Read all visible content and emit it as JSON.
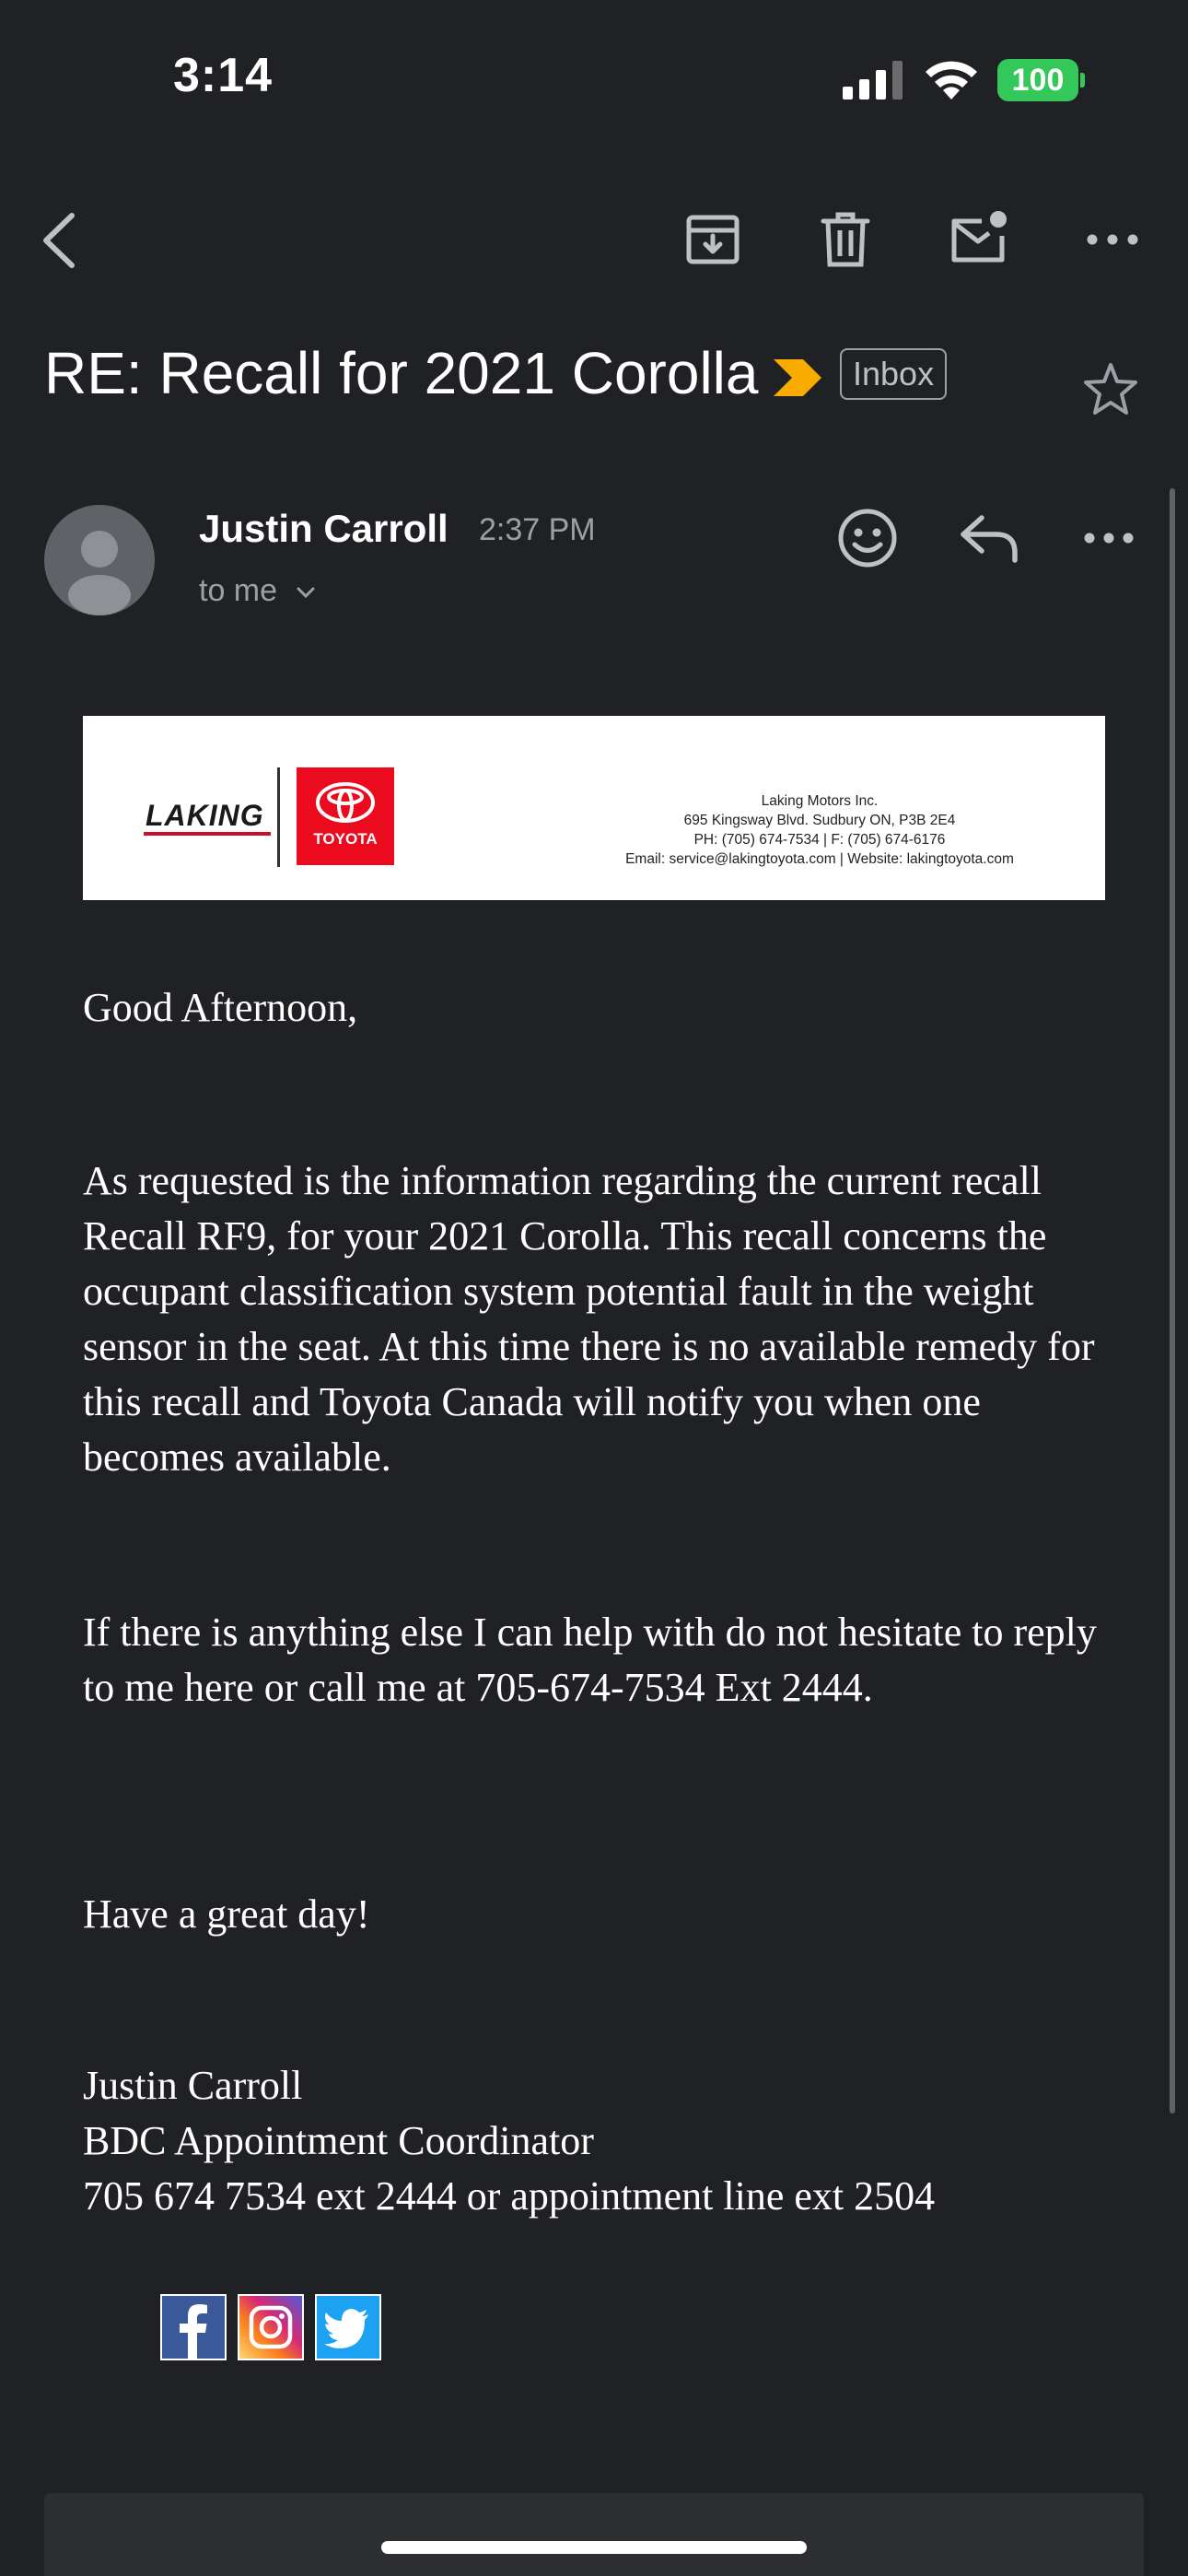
{
  "status_bar": {
    "time": "3:14",
    "battery": "100",
    "icons": [
      "signal-icon",
      "wifi-icon",
      "battery-icon"
    ]
  },
  "toolbar": {
    "icons": [
      "back-icon",
      "archive-icon",
      "trash-icon",
      "mark-unread-icon",
      "more-icon"
    ]
  },
  "email": {
    "subject": "RE: Recall for 2021 Corolla",
    "label": "Inbox",
    "sender": "Justin Carroll",
    "time": "2:37 PM",
    "recipient": "to me",
    "banner": {
      "brand": "LAKING",
      "logo_text": "TOYOTA",
      "company": "Laking Motors Inc.",
      "address": "695 Kingsway Blvd. Sudbury ON, P3B 2E4",
      "phone": "PH: (705) 674-7534 | F: (705) 674-6176",
      "contact": "Email: service@lakingtoyota.com | Website: lakingtoyota.com"
    },
    "greeting": "Good Afternoon,",
    "paragraph1": "As requested is the information regarding the current recall Recall RF9, for your 2021 Corolla. This recall concerns the occupant classification system potential fault in the weight sensor in the seat. At this time there is no available remedy for this recall and Toyota Canada will notify you when one becomes available.",
    "paragraph2": "If there is anything else I can help with do not hesitate to reply to me here or call me at 705-674-7534 Ext 2444.",
    "closing": "Have a great day!",
    "signature": {
      "name": "Justin Carroll",
      "title": "BDC Appointment Coordinator",
      "phone": "705 674 7534 ext 2444 or appointment line ext 2504"
    },
    "social_icons": [
      "facebook-icon",
      "instagram-icon",
      "twitter-icon"
    ]
  },
  "colors": {
    "background": "#202124",
    "importance": "#f9ab00",
    "battery": "#34c759",
    "toyota_red": "#eb0a1e"
  }
}
